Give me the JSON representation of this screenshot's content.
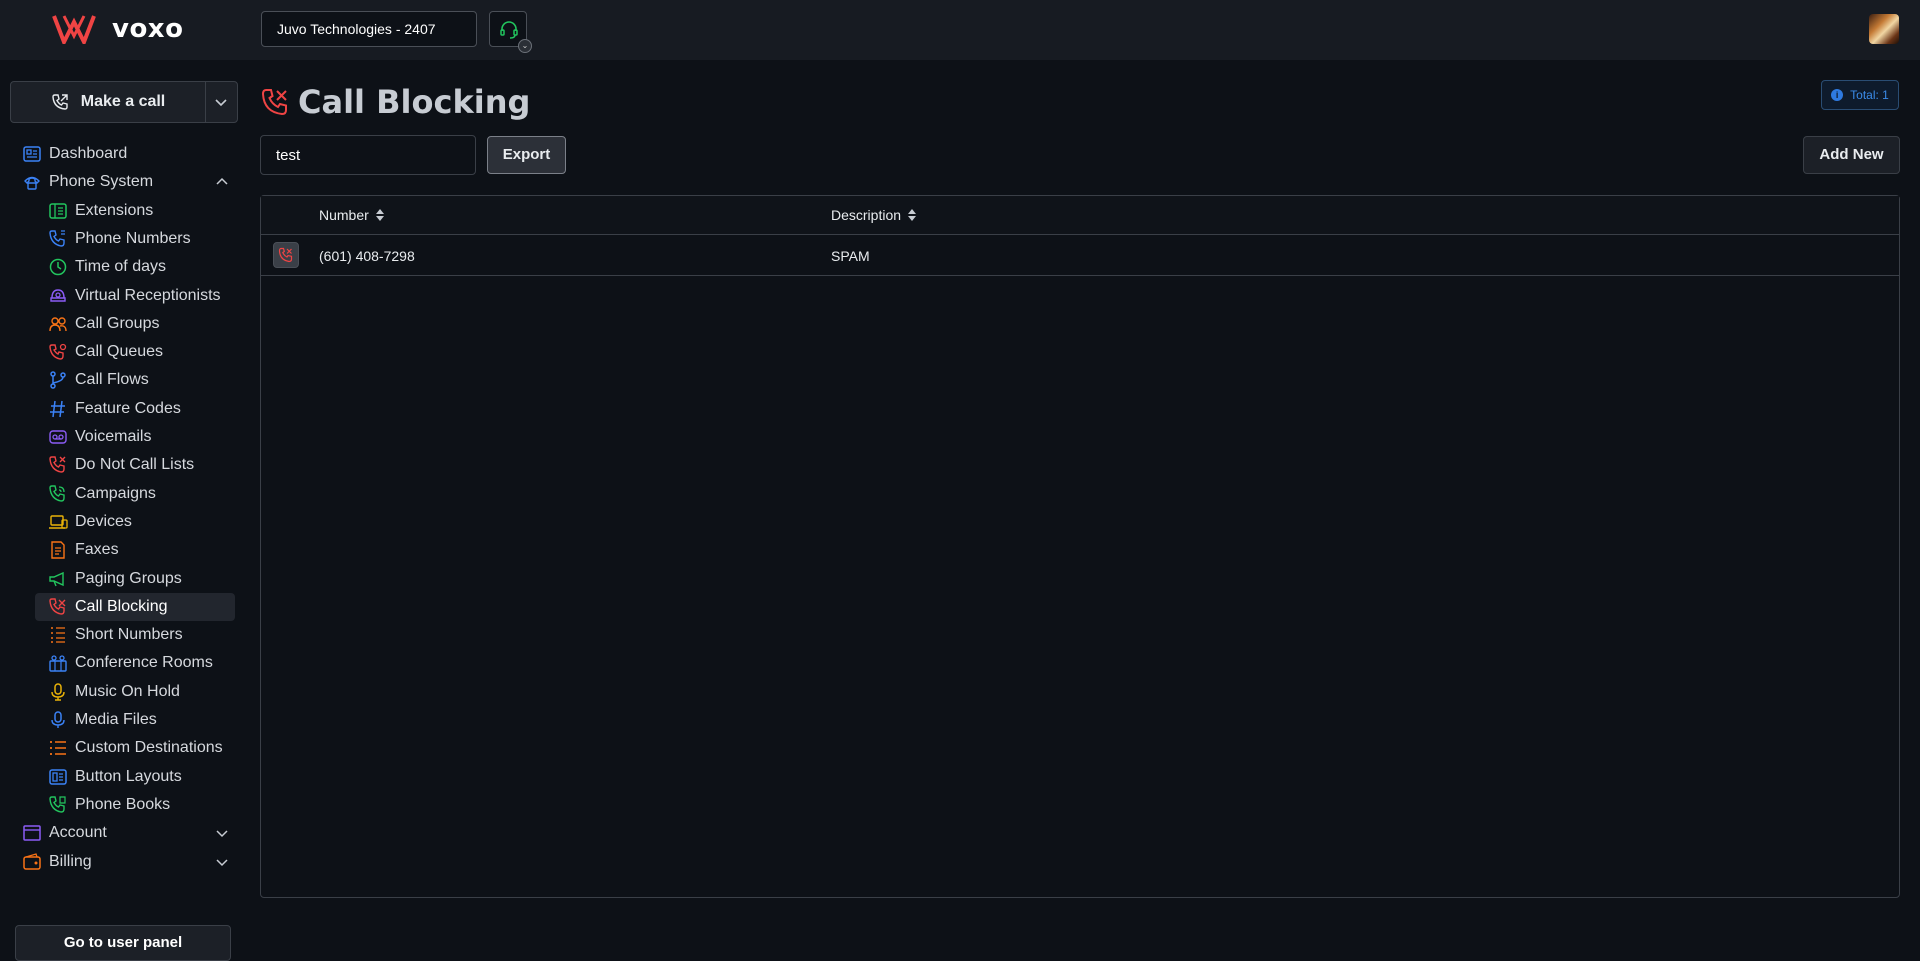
{
  "app": {
    "logo_text": "voxo"
  },
  "header": {
    "tenant_name": "Juvo Technologies - 2407"
  },
  "sidebar": {
    "make_call_label": "Make a call",
    "go_user_panel_label": "Go to user panel",
    "items": [
      {
        "label": "Dashboard",
        "icon": "dashboard-icon",
        "level": "top",
        "color": "#3b82f6"
      },
      {
        "label": "Phone System",
        "icon": "phone-system-icon",
        "level": "top",
        "color": "#3b82f6",
        "expanded": true
      },
      {
        "label": "Extensions",
        "icon": "extensions-icon",
        "level": "sub",
        "color": "#22c55e"
      },
      {
        "label": "Phone Numbers",
        "icon": "phone-numbers-icon",
        "level": "sub",
        "color": "#3b82f6"
      },
      {
        "label": "Time of days",
        "icon": "clock-icon",
        "level": "sub",
        "color": "#22c55e"
      },
      {
        "label": "Virtual Receptionists",
        "icon": "receptionist-icon",
        "level": "sub",
        "color": "#8b5cf6"
      },
      {
        "label": "Call Groups",
        "icon": "call-groups-icon",
        "level": "sub",
        "color": "#f97316"
      },
      {
        "label": "Call Queues",
        "icon": "call-queues-icon",
        "level": "sub",
        "color": "#ef4444"
      },
      {
        "label": "Call Flows",
        "icon": "call-flows-icon",
        "level": "sub",
        "color": "#3b82f6"
      },
      {
        "label": "Feature Codes",
        "icon": "hash-icon",
        "level": "sub",
        "color": "#3b82f6"
      },
      {
        "label": "Voicemails",
        "icon": "voicemail-icon",
        "level": "sub",
        "color": "#8b5cf6"
      },
      {
        "label": "Do Not Call Lists",
        "icon": "do-not-call-icon",
        "level": "sub",
        "color": "#ef4444"
      },
      {
        "label": "Campaigns",
        "icon": "campaigns-icon",
        "level": "sub",
        "color": "#22c55e"
      },
      {
        "label": "Devices",
        "icon": "devices-icon",
        "level": "sub",
        "color": "#eab308"
      },
      {
        "label": "Faxes",
        "icon": "fax-icon",
        "level": "sub",
        "color": "#f97316"
      },
      {
        "label": "Paging Groups",
        "icon": "megaphone-icon",
        "level": "sub",
        "color": "#22c55e"
      },
      {
        "label": "Call Blocking",
        "icon": "call-blocking-icon",
        "level": "sub",
        "color": "#ef4444",
        "active": true
      },
      {
        "label": "Short Numbers",
        "icon": "short-numbers-icon",
        "level": "sub",
        "color": "#f97316"
      },
      {
        "label": "Conference Rooms",
        "icon": "conference-icon",
        "level": "sub",
        "color": "#3b82f6"
      },
      {
        "label": "Music On Hold",
        "icon": "microphone-icon",
        "level": "sub",
        "color": "#eab308"
      },
      {
        "label": "Media Files",
        "icon": "media-mic-icon",
        "level": "sub",
        "color": "#3b82f6"
      },
      {
        "label": "Custom Destinations",
        "icon": "list-icon",
        "level": "sub",
        "color": "#f97316"
      },
      {
        "label": "Button Layouts",
        "icon": "button-layouts-icon",
        "level": "sub",
        "color": "#3b82f6"
      },
      {
        "label": "Phone Books",
        "icon": "phone-books-icon",
        "level": "sub",
        "color": "#22c55e"
      },
      {
        "label": "Account",
        "icon": "account-icon",
        "level": "top",
        "color": "#8b5cf6",
        "chevron": true
      },
      {
        "label": "Billing",
        "icon": "billing-icon",
        "level": "top",
        "color": "#f97316",
        "chevron": true
      }
    ]
  },
  "page": {
    "title": "Call Blocking",
    "total_label": "Total: 1",
    "search_value": "test",
    "export_label": "Export",
    "add_new_label": "Add New"
  },
  "table": {
    "columns": [
      "Number",
      "Description"
    ],
    "rows": [
      {
        "number": "(601) 408-7298",
        "description": "SPAM"
      }
    ]
  },
  "colors": {
    "accent_red": "#ef4444",
    "background": "#0d1117",
    "topbar": "#171b22"
  }
}
